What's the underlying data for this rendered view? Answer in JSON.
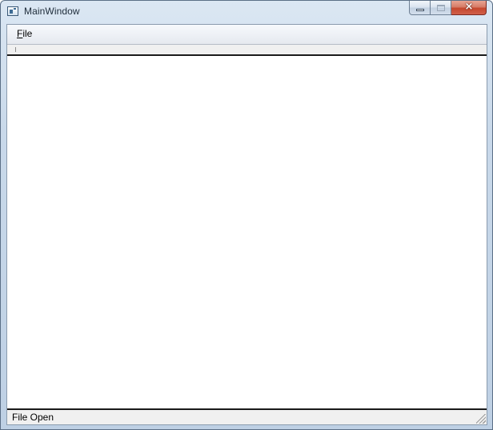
{
  "window": {
    "title": "MainWindow",
    "icon": "app-window-icon",
    "controls": {
      "minimize": "minimize-icon",
      "maximize": "maximize-icon",
      "close": "×"
    }
  },
  "menubar": {
    "items": [
      {
        "accel": "F",
        "rest": "ile"
      }
    ]
  },
  "statusbar": {
    "text": "File Open"
  },
  "colors": {
    "close_button": "#c5472e",
    "content_background": "#ffffff",
    "separator": "#1a1a1a"
  }
}
